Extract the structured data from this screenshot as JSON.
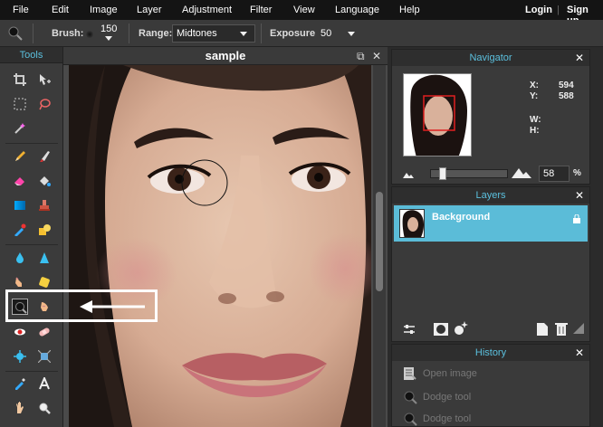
{
  "menu": {
    "items": [
      "File",
      "Edit",
      "Image",
      "Layer",
      "Adjustment",
      "Filter",
      "View",
      "Language",
      "Help"
    ],
    "login": "Login",
    "separator": "|",
    "signup": "Sign up"
  },
  "options": {
    "brush_label": "Brush:",
    "brush_size": "150",
    "range_label": "Range:",
    "range_value": "Midtones",
    "exposure_label": "Exposure:",
    "exposure_value": "50"
  },
  "tools": {
    "title": "Tools"
  },
  "canvas": {
    "title": "sample",
    "close_glyph": "✕",
    "restore_glyph": "⧉"
  },
  "navigator": {
    "title": "Navigator",
    "x_label": "X:",
    "x_value": "594",
    "y_label": "Y:",
    "y_value": "588",
    "w_label": "W:",
    "h_label": "H:",
    "zoom_value": "58",
    "zoom_unit": "%",
    "zoom_level": 0.12
  },
  "layers": {
    "title": "Layers",
    "items": [
      {
        "name": "Background"
      }
    ]
  },
  "history": {
    "title": "History",
    "items": [
      {
        "label": "Open image",
        "icon": "open-image-icon"
      },
      {
        "label": "Dodge tool",
        "icon": "dodge-tool-icon"
      },
      {
        "label": "Dodge tool",
        "icon": "dodge-tool-icon"
      }
    ]
  },
  "colors": {
    "accent": "#5bc0de",
    "selected_layer": "#5bbcd8"
  }
}
